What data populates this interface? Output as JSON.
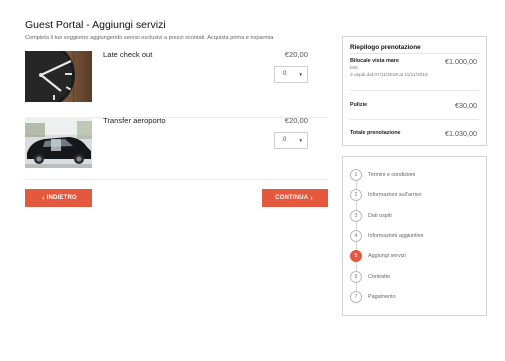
{
  "header": {
    "title": "Guest Portal - Aggiungi servizi",
    "subtitle": "Completa il tuo soggiorno aggiungendo servizi esclusivi a prezzi scontati. Acquista prima e risparmia"
  },
  "services": [
    {
      "name": "Late check out",
      "price": "€20,00",
      "quantity": "0",
      "image_icon": "clock-photo"
    },
    {
      "name": "Transfer aeroporto",
      "price": "€20,00",
      "quantity": "0",
      "image_icon": "car-photo"
    }
  ],
  "buttons": {
    "back_label": "INDIETRO",
    "next_label": "CONTINUA",
    "accent_color": "#e4583e"
  },
  "summary": {
    "title": "Riepilogo prenotazione",
    "room_name": "Bilocale vista mare",
    "room_price": "€1.000,00",
    "room_note": "test",
    "room_dates": "3 ospiti dal 07/11/2019 al 11/11/2019",
    "cleaning_label": "Pulizie",
    "cleaning_price": "€30,00",
    "total_label": "Totale prenotazione",
    "total_price": "€1.030,00"
  },
  "steps": [
    {
      "num": "1",
      "label": "Termini e condizioni",
      "active": false
    },
    {
      "num": "2",
      "label": "Informazioni sull'arrivo",
      "active": false
    },
    {
      "num": "3",
      "label": "Dati ospiti",
      "active": false
    },
    {
      "num": "4",
      "label": "Informazioni aggiuntive",
      "active": false
    },
    {
      "num": "5",
      "label": "Aggiungi servizi",
      "active": true
    },
    {
      "num": "6",
      "label": "Contratto",
      "active": false
    },
    {
      "num": "7",
      "label": "Pagamento",
      "active": false
    }
  ]
}
